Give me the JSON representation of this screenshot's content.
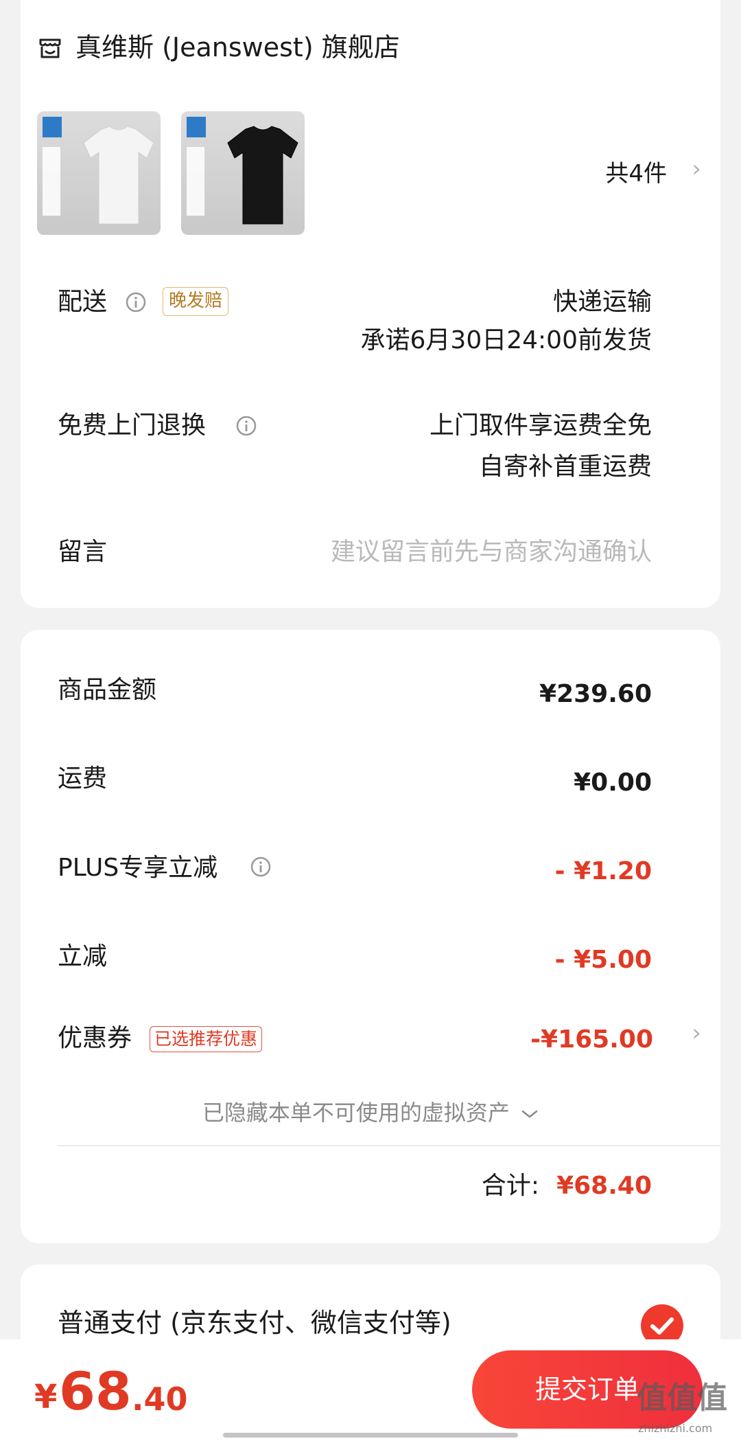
{
  "store": {
    "name": "真维斯 (Jeanswest) 旗舰店",
    "icon": "store-icon"
  },
  "products": {
    "count_label": "共4件",
    "items": [
      {
        "color": "white",
        "shirt_hex": "#f4f4f4"
      },
      {
        "color": "black",
        "shirt_hex": "#161616"
      }
    ]
  },
  "delivery": {
    "label": "配送",
    "badge": "晚发赔",
    "method": "快递运输",
    "promise": "承诺6月30日24:00前发货"
  },
  "returns": {
    "label": "免费上门退换",
    "line1": "上门取件享运费全免",
    "line2": "自寄补首重运费"
  },
  "message": {
    "label": "留言",
    "placeholder": "建议留言前先与商家沟通确认"
  },
  "amounts": {
    "goods_label": "商品金额",
    "goods_value": "¥239.60",
    "shipping_label": "运费",
    "shipping_value": "¥0.00",
    "plus_label": "PLUS专享立减",
    "plus_value": "- ¥1.20",
    "discount_label": "立减",
    "discount_value": "- ¥5.00",
    "coupon_label": "优惠券",
    "coupon_badge": "已选推荐优惠",
    "coupon_value": "-¥165.00",
    "hidden_assets": "已隐藏本单不可使用的虚拟资产",
    "total_label": "合计:",
    "total_value": "¥68.40"
  },
  "payment": {
    "method_label": "普通支付 (京东支付、微信支付等)",
    "selected": true
  },
  "bottom": {
    "price_symbol": "¥",
    "price_integer": "68",
    "price_decimal": ".40",
    "submit_label": "提交订单"
  },
  "watermark": {
    "mark": "值值值",
    "url": "zhizhizhi.com"
  },
  "colors": {
    "accent": "#e03a24",
    "button": "#f23d3a",
    "badge_gold": "#b37b22"
  }
}
